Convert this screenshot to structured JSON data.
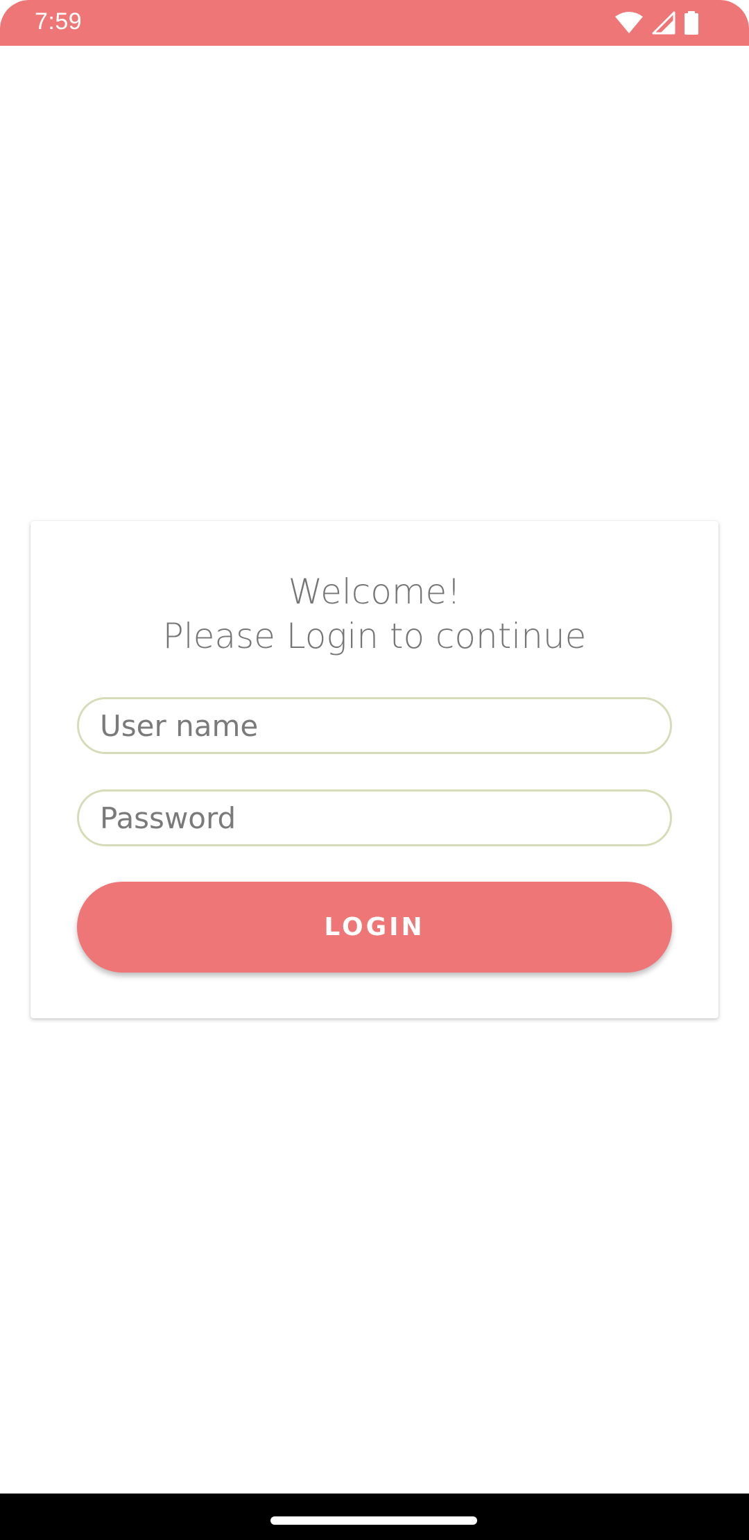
{
  "status_bar": {
    "time": "7:59",
    "icons": [
      "wifi-icon",
      "cell-signal-icon",
      "battery-icon"
    ],
    "color": "#ef7676"
  },
  "login": {
    "welcome_line1": "Welcome!",
    "welcome_line2": "Please Login to continue",
    "username_placeholder": "User name",
    "username_value": "",
    "password_placeholder": "Password",
    "password_value": "",
    "login_label": "LOGIN",
    "accent_color": "#ef7676",
    "field_border_color": "#d6dbb8"
  },
  "nav_bar": {
    "handle": "home-handle"
  }
}
